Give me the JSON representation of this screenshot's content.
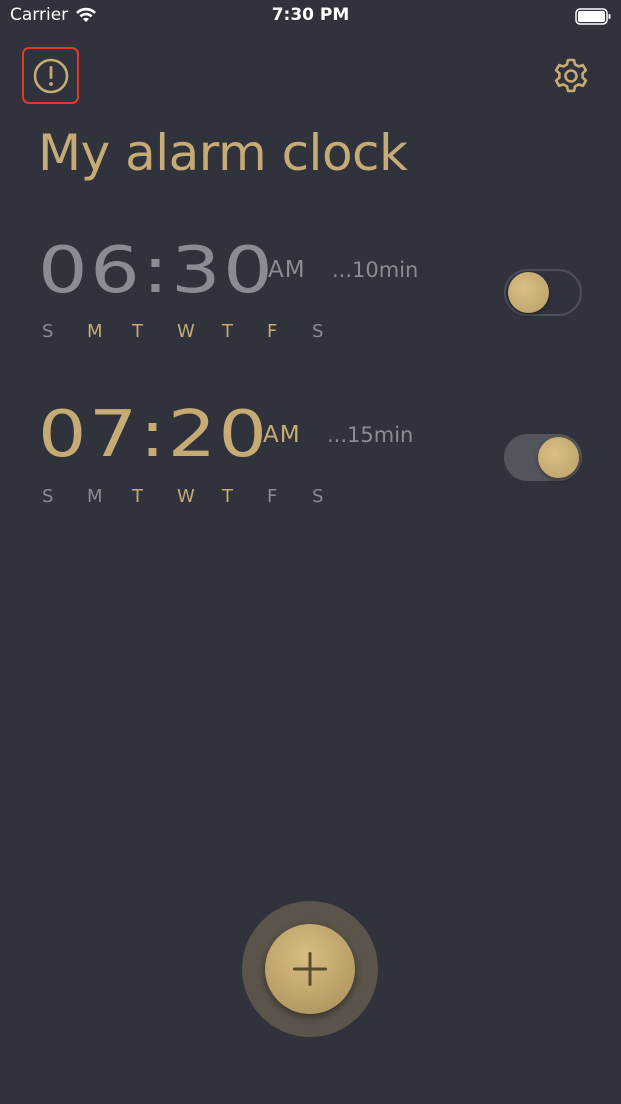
{
  "status_bar": {
    "carrier": "Carrier",
    "time": "7:30 PM"
  },
  "header": {
    "title": "My alarm clock",
    "info_icon": "exclamation-circle-icon",
    "settings_icon": "gear-icon"
  },
  "colors": {
    "background": "#30323c",
    "accent": "#c6ab74",
    "inactive": "#8b8c93",
    "alert_outline": "#e03a2b"
  },
  "alarms": [
    {
      "time": "06:30",
      "ampm": "AM",
      "snooze": "...10min",
      "enabled": false,
      "days": [
        {
          "label": "S",
          "active": false
        },
        {
          "label": "M",
          "active": true
        },
        {
          "label": "T",
          "active": true
        },
        {
          "label": "W",
          "active": true
        },
        {
          "label": "T",
          "active": true
        },
        {
          "label": "F",
          "active": true
        },
        {
          "label": "S",
          "active": false
        }
      ]
    },
    {
      "time": "07:20",
      "ampm": "AM",
      "snooze": "...15min",
      "enabled": true,
      "days": [
        {
          "label": "S",
          "active": false
        },
        {
          "label": "M",
          "active": false
        },
        {
          "label": "T",
          "active": true
        },
        {
          "label": "W",
          "active": true
        },
        {
          "label": "T",
          "active": true
        },
        {
          "label": "F",
          "active": false
        },
        {
          "label": "S",
          "active": false
        }
      ]
    }
  ],
  "add_button": {
    "icon": "plus-icon"
  }
}
